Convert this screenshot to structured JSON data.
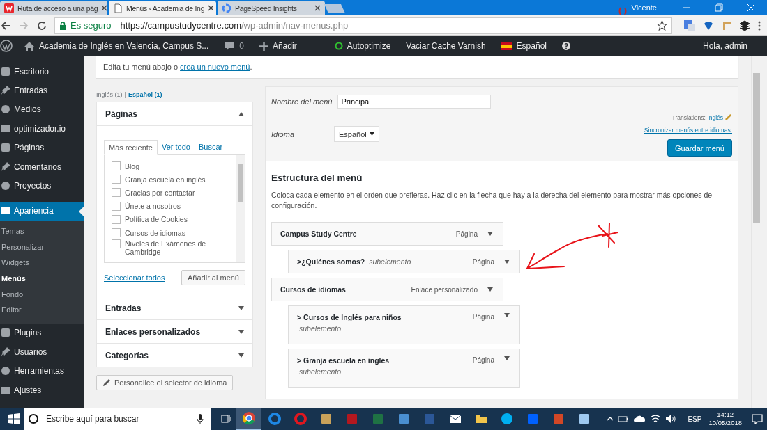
{
  "browser": {
    "tabs": [
      {
        "title": "Ruta de acceso a una pág",
        "selected": false
      },
      {
        "title": "Menús ‹ Academia de Ing",
        "selected": true
      },
      {
        "title": "PageSpeed Insights",
        "selected": false
      }
    ],
    "profile": "Vicente",
    "security": "Es seguro",
    "url_host": "https://campustudycentre.com",
    "url_path": "/wp-admin/nav-menus.php"
  },
  "admin_bar": {
    "site": "Academia de Inglés en Valencia, Campus S...",
    "comments": "0",
    "new": "Añadir",
    "autoptimize": "Autoptimize",
    "cache": "Vaciar Cache Varnish",
    "language": "Español",
    "greeting": "Hola, admin"
  },
  "sidebar": {
    "items": [
      {
        "label": "Escritorio",
        "selected": false
      },
      {
        "label": "Entradas",
        "selected": false
      },
      {
        "label": "Medios",
        "selected": false
      },
      {
        "label": "optimizador.io",
        "selected": false
      },
      {
        "label": "Páginas",
        "selected": false
      },
      {
        "label": "Comentarios",
        "selected": false
      },
      {
        "label": "Proyectos",
        "selected": false
      },
      {
        "label": "Apariencia",
        "selected": true,
        "children": [
          {
            "label": "Temas",
            "selected": false
          },
          {
            "label": "Personalizar",
            "selected": false
          },
          {
            "label": "Widgets",
            "selected": false
          },
          {
            "label": "Menús",
            "selected": true
          },
          {
            "label": "Fondo",
            "selected": false
          },
          {
            "label": "Editor",
            "selected": false
          }
        ]
      },
      {
        "label": "Plugins",
        "selected": false
      },
      {
        "label": "Usuarios",
        "selected": false
      },
      {
        "label": "Herramientas",
        "selected": false
      },
      {
        "label": "Ajustes",
        "selected": false
      }
    ]
  },
  "notice": {
    "text": "Edita tu menú abajo o ",
    "link": "crea un nuevo menú",
    "end": "."
  },
  "languages": {
    "separator": "|",
    "items": [
      {
        "label": "Inglés (1)",
        "selected": false
      },
      {
        "label": "Español (1)",
        "selected": true
      }
    ]
  },
  "add_panel": {
    "title": "Páginas",
    "expanded": true,
    "tabs": [
      {
        "label": "Más reciente",
        "selected": true
      },
      {
        "label": "Ver todo",
        "selected": false
      },
      {
        "label": "Buscar",
        "selected": false
      }
    ],
    "items": [
      {
        "label": "Blog",
        "checked": false
      },
      {
        "label": "Granja escuela en inglés",
        "checked": false
      },
      {
        "label": "Gracias por contactar",
        "checked": false
      },
      {
        "label": "Únete a nosotros",
        "checked": false
      },
      {
        "label": "Política de Cookies",
        "checked": false
      },
      {
        "label": "Cursos de idiomas",
        "checked": false
      },
      {
        "label": "Niveles de Exámenes de Cambridge",
        "checked": false
      }
    ],
    "select_all": "Seleccionar todos",
    "add_button": "Añadir al menú",
    "sections": [
      {
        "title": "Entradas",
        "expanded": false
      },
      {
        "title": "Enlaces personalizados",
        "expanded": false
      },
      {
        "title": "Categorías",
        "expanded": false
      }
    ],
    "language_button": "Personalice el selector de idioma"
  },
  "menu_settings": {
    "name_label": "Nombre del menú",
    "name": "Principal",
    "language_label": "Idioma",
    "language": "Español",
    "translations_label": "Translations:",
    "translations_link": "Inglés",
    "sync_link": "Sincronizar menús entre idiomas.",
    "save": "Guardar menú"
  },
  "structure": {
    "title": "Estructura del menú",
    "description": "Coloca cada elemento en el orden que prefieras. Haz clic en la flecha que hay a la derecha del elemento para mostrar más opciones de configuración.",
    "items": [
      {
        "title": "Campus Study Centre",
        "type": "Página",
        "children": [
          {
            "title": ">¿Quiénes somos?",
            "note": "subelemento",
            "kind": "inline",
            "type": "Página"
          }
        ]
      },
      {
        "title": "Cursos de idiomas",
        "type": "Enlace personalizado",
        "children": [
          {
            "title": "> Cursos de Inglés para niños",
            "note": "subelemento",
            "kind": "stacked",
            "type": "Página"
          },
          {
            "title": "> Granja escuela en inglés",
            "note": "subelemento",
            "kind": "stacked",
            "type": "Página"
          }
        ]
      }
    ]
  },
  "taskbar": {
    "search_placeholder": "Escribe aquí para buscar",
    "apps": [
      {
        "kind": "browser",
        "selected": true
      },
      {
        "kind": "edge",
        "selected": false
      },
      {
        "kind": "opera",
        "selected": false
      },
      {
        "kind": "palette",
        "selected": false
      },
      {
        "kind": "ftp",
        "selected": false
      },
      {
        "kind": "sheet",
        "selected": false
      },
      {
        "kind": "viewer",
        "selected": false
      },
      {
        "kind": "doc",
        "selected": false
      },
      {
        "kind": "mail",
        "selected": false
      },
      {
        "kind": "folder",
        "selected": false
      },
      {
        "kind": "chat",
        "selected": false
      },
      {
        "kind": "box",
        "selected": false
      },
      {
        "kind": "slides",
        "selected": false
      },
      {
        "kind": "notes",
        "selected": false
      }
    ],
    "language": "ESP",
    "time": "14:12",
    "date": "10/05/2018"
  }
}
